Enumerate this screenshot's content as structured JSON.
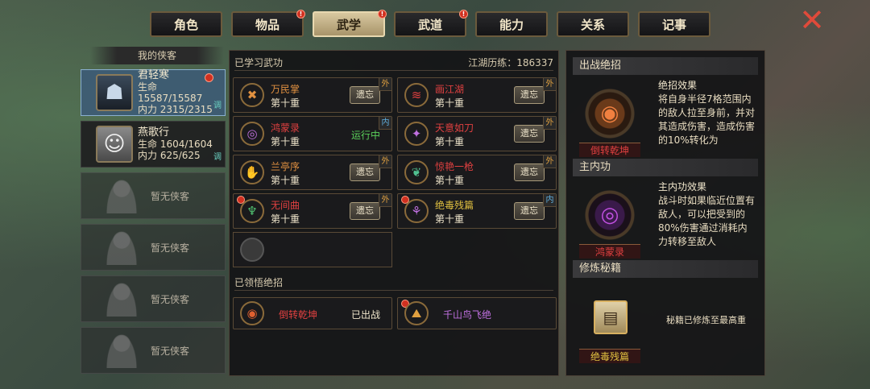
{
  "tabs": [
    {
      "label": "角色",
      "active": false,
      "alert": false
    },
    {
      "label": "物品",
      "active": false,
      "alert": true
    },
    {
      "label": "武学",
      "active": true,
      "alert": true
    },
    {
      "label": "武道",
      "active": false,
      "alert": true
    },
    {
      "label": "能力",
      "active": false,
      "alert": false
    },
    {
      "label": "关系",
      "active": false,
      "alert": false
    },
    {
      "label": "记事",
      "active": false,
      "alert": false
    }
  ],
  "roster": {
    "title": "我的侠客",
    "heroes": [
      {
        "name": "君轻寒",
        "hp": "生命 15587/15587",
        "mp": "内力 2315/2315",
        "flag": "调"
      },
      {
        "name": "燕歌行",
        "hp": "生命 1604/1604",
        "mp": "内力 625/625",
        "flag": "调"
      }
    ],
    "empty_label": "暂无侠客"
  },
  "learned": {
    "title": "已学习武功",
    "experience": "江湖历练：186337",
    "skills": [
      {
        "name": "万民掌",
        "level": "第十重",
        "action": "遗忘",
        "tag": "外",
        "color": "orange",
        "icon": "✖"
      },
      {
        "name": "画江湖",
        "level": "第十重",
        "action": "遗忘",
        "tag": "外",
        "color": "red",
        "icon": "≋"
      },
      {
        "name": "鸿蒙录",
        "level": "第十重",
        "status": "运行中",
        "tag": "内",
        "color": "red",
        "icon": "◎"
      },
      {
        "name": "天意如刀",
        "level": "第十重",
        "action": "遗忘",
        "tag": "外",
        "color": "red",
        "icon": "✦"
      },
      {
        "name": "兰亭序",
        "level": "第十重",
        "action": "遗忘",
        "tag": "外",
        "color": "orange",
        "icon": "✋"
      },
      {
        "name": "惊艳一枪",
        "level": "第十重",
        "action": "遗忘",
        "tag": "外",
        "color": "red",
        "icon": "❦"
      },
      {
        "name": "无间曲",
        "level": "第十重",
        "action": "遗忘",
        "tag": "外",
        "color": "red",
        "icon": "♆"
      },
      {
        "name": "绝毒残篇",
        "level": "第十重",
        "action": "遗忘",
        "tag": "内",
        "color": "yellow",
        "icon": "⚘"
      }
    ]
  },
  "mastered": {
    "title": "已领悟绝招",
    "moves": [
      {
        "name": "倒转乾坤",
        "status": "已出战",
        "color": "red",
        "icon": "◉"
      },
      {
        "name": "千山鸟飞绝",
        "color": "purple",
        "icon": "⛰"
      }
    ]
  },
  "right": {
    "battle_head": "出战绝招",
    "battle_title": "绝招效果",
    "battle_desc": "将自身半径7格范围内的敌人拉至身前，并对其造成伤害，造成伤害的10%转化为",
    "battle_name": "倒转乾坤",
    "inner_head": "主内功",
    "inner_title": "主内功效果",
    "inner_desc": "战斗时如果临近位置有敌人，可以把受到的80%伤害通过消耗内力转移至敌人",
    "inner_name": "鸿蒙录",
    "book_head": "修炼秘籍",
    "book_note": "秘籍已修炼至最高重",
    "book_name": "绝毒残篇"
  },
  "colors": {
    "accent_red": "#e04040",
    "running_green": "#5ad05a",
    "tab_active": "#d8c8a0"
  }
}
